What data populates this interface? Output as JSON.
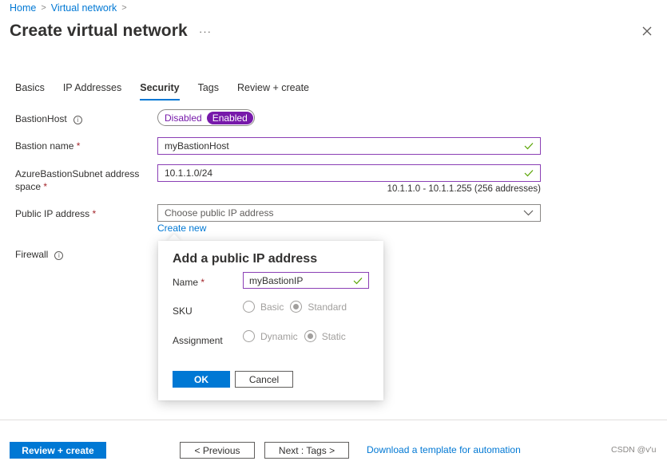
{
  "breadcrumb": {
    "items": [
      "Home",
      "Virtual network"
    ],
    "separator": ">"
  },
  "header": {
    "title": "Create virtual network",
    "more_label": "···",
    "close_icon": "close-icon"
  },
  "tabs": [
    {
      "label": "Basics",
      "active": false
    },
    {
      "label": "IP Addresses",
      "active": false
    },
    {
      "label": "Security",
      "active": true
    },
    {
      "label": "Tags",
      "active": false
    },
    {
      "label": "Review + create",
      "active": false
    }
  ],
  "form": {
    "bastion_host": {
      "label": "BastionHost",
      "options": [
        "Disabled",
        "Enabled"
      ],
      "selected": "Enabled"
    },
    "bastion_name": {
      "label": "Bastion name",
      "required_mark": "*",
      "value": "myBastionHost",
      "valid": true
    },
    "subnet_space": {
      "label": "AzureBastionSubnet address space",
      "required_mark": "*",
      "value": "10.1.1.0/24",
      "valid": true,
      "hint": "10.1.1.0 - 10.1.1.255 (256 addresses)"
    },
    "public_ip": {
      "label": "Public IP address",
      "required_mark": "*",
      "placeholder": "Choose public IP address",
      "create_new_label": "Create new"
    },
    "firewall": {
      "label": "Firewall"
    }
  },
  "callout": {
    "title": "Add a public IP address",
    "name": {
      "label": "Name",
      "required_mark": "*",
      "value": "myBastionIP",
      "valid": true
    },
    "sku": {
      "label": "SKU",
      "options": [
        "Basic",
        "Standard"
      ],
      "selected": "Standard",
      "disabled": true
    },
    "assignment": {
      "label": "Assignment",
      "options": [
        "Dynamic",
        "Static"
      ],
      "selected": "Static",
      "disabled": true
    },
    "ok_label": "OK",
    "cancel_label": "Cancel"
  },
  "footer": {
    "review_create_label": "Review + create",
    "previous_label": "< Previous",
    "next_label": "Next : Tags >",
    "download_link": "Download a template for automation"
  },
  "watermark": "CSDN @v'u",
  "colors": {
    "accent_blue": "#0078d4",
    "toggle_purple": "#7719aa",
    "valid_green": "#57a300",
    "required_red": "#a4262c"
  }
}
